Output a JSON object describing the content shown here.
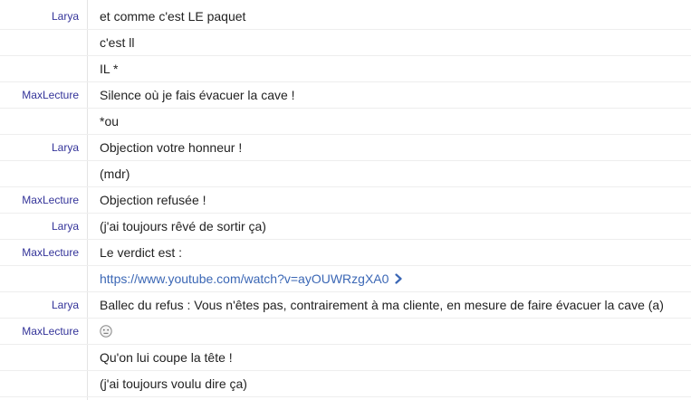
{
  "messages": [
    {
      "author": "Larya",
      "text": "et comme c'est LE paquet"
    },
    {
      "author": "",
      "text": "c'est ll"
    },
    {
      "author": "",
      "text": "IL *"
    },
    {
      "author": "MaxLecture",
      "text": "Silence où je fais évacuer la cave !"
    },
    {
      "author": "",
      "text": "*ou"
    },
    {
      "author": "Larya",
      "text": "Objection votre honneur !"
    },
    {
      "author": "",
      "text": "(mdr)"
    },
    {
      "author": "MaxLecture",
      "text": "Objection refusée !"
    },
    {
      "author": "Larya",
      "text": "(j'ai toujours rêvé de sortir ça)"
    },
    {
      "author": "MaxLecture",
      "text": "Le verdict est :"
    },
    {
      "author": "",
      "link": "https://www.youtube.com/watch?v=ayOUWRzgXA0",
      "link_icon": "chevron-right-icon"
    },
    {
      "author": "Larya",
      "text": "Ballec du refus : Vous n'êtes pas, contrairement à ma cliente, en mesure de faire évacuer la cave (a)"
    },
    {
      "author": "MaxLecture",
      "emoji": "neutral-face-icon"
    },
    {
      "author": "",
      "text": "Qu'on lui coupe la têt ̇e !"
    },
    {
      "author": "",
      "text": "(j'ai toujours voulu dire ça)"
    }
  ],
  "colors": {
    "author": "#333399",
    "text": "#222222",
    "link": "#3b67b5",
    "divider": "#eeeeee"
  }
}
